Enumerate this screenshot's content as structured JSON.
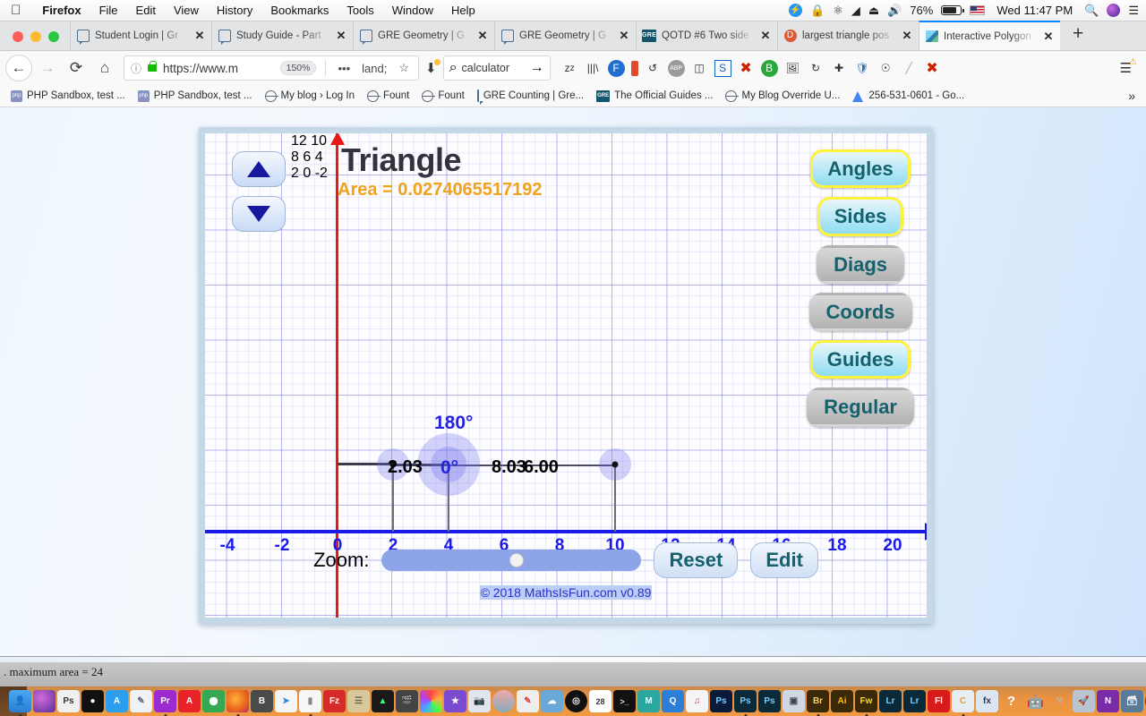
{
  "menubar": {
    "apple_icon": "apple-logo",
    "items": [
      "Firefox",
      "File",
      "Edit",
      "View",
      "History",
      "Bookmarks",
      "Tools",
      "Window",
      "Help"
    ],
    "status_icons": [
      "bluetooth-transfer-icon",
      "lock-icon",
      "bluetooth-icon",
      "wifi-icon",
      "eject-icon",
      "volume-icon"
    ],
    "battery_percent": "76%",
    "flag_icon": "us-flag-icon",
    "clock": "Wed 11:47 PM",
    "search_icon": "spotlight-search-icon",
    "siri_icon": "siri-icon",
    "notifications_icon": "notification-center-icon"
  },
  "tabs": [
    {
      "label": "Student Login | Gr",
      "favicon": "doc-icon",
      "active": false
    },
    {
      "label": "Study Guide - Part",
      "favicon": "doc-icon",
      "active": false
    },
    {
      "label": "GRE Geometry | G",
      "favicon": "doc-icon",
      "active": false
    },
    {
      "label": "GRE Geometry | G",
      "favicon": "doc-icon",
      "active": false
    },
    {
      "label": "QOTD #6 Two side",
      "favicon": "gre-icon",
      "active": false
    },
    {
      "label": "largest triangle pos",
      "favicon": "duckduckgo-icon",
      "active": false
    },
    {
      "label": "Interactive Polygon",
      "favicon": "mathsisfun-icon",
      "active": true
    }
  ],
  "tab_close_label": "✕",
  "newtab_label": "+",
  "navbar": {
    "back_icon": "←",
    "forward_icon": "→",
    "reload_icon": "⟳",
    "home_icon": "⌂",
    "info_icon": "ⓘ",
    "lock_icon": "padlock-icon",
    "url": "https://www.m",
    "zoom_badge": "150%",
    "more_icon": "•••",
    "pocket_icon": "pocket-icon",
    "bookmark_star_icon": "☆",
    "downloads_icon": "⬇",
    "search_icon": "⌕",
    "search_value": "calculator",
    "search_go_icon": "→",
    "extensions": [
      "zzz-icon",
      "library-icon",
      "f-circle-icon",
      "thermometer-icon",
      "loop-icon",
      "abp-icon",
      "panel-icon",
      "s-icon",
      "x-red-icon",
      "b-plus-icon",
      "image-icon",
      "refresh-icon",
      "move-icon",
      "shield-icon",
      "face-icon",
      "pencil-icon",
      "x-red2-icon"
    ],
    "menu_icon": "hamburger-menu-icon",
    "menu_warning_icon": "warning-icon"
  },
  "bookmarks": [
    {
      "label": "PHP Sandbox, test ...",
      "icon": "php-icon"
    },
    {
      "label": "PHP Sandbox, test ...",
      "icon": "php-icon"
    },
    {
      "label": "My blog › Log In",
      "icon": "globe-icon"
    },
    {
      "label": "Fount",
      "icon": "globe-icon"
    },
    {
      "label": "Fount",
      "icon": "globe-icon"
    },
    {
      "label": "GRE Counting | Gre...",
      "icon": "doc-icon"
    },
    {
      "label": "The Official Guides ...",
      "icon": "gre-icon"
    },
    {
      "label": "My Blog Override U...",
      "icon": "globe-icon"
    },
    {
      "label": "256-531-0601 - Go...",
      "icon": "ads-icon"
    }
  ],
  "bookmarks_overflow_icon": "»",
  "app": {
    "title": "Triangle",
    "area_label": "Area = 0.0274065517192",
    "copyright": "© 2018 MathsIsFun.com v0.89",
    "stepper": {
      "up_icon": "triangle-up-icon",
      "down_icon": "triangle-down-icon"
    },
    "toggles": [
      {
        "label": "Angles",
        "active": true
      },
      {
        "label": "Sides",
        "active": true
      },
      {
        "label": "Diags",
        "active": false
      },
      {
        "label": "Coords",
        "active": false
      },
      {
        "label": "Guides",
        "active": true
      },
      {
        "label": "Regular",
        "active": false
      }
    ],
    "zoom_label": "Zoom:",
    "zoom_value": 50,
    "reset_label": "Reset",
    "edit_label": "Edit"
  },
  "chart_data": {
    "type": "scatter",
    "title": "Triangle",
    "subtitle": "Area = 0.0274065517192",
    "xlabel": "",
    "ylabel": "",
    "xlim": [
      -5,
      21
    ],
    "ylim": [
      -3,
      13
    ],
    "grid": true,
    "x_ticks": [
      "-4",
      "-2",
      "0",
      "2",
      "4",
      "6",
      "8",
      "10",
      "12",
      "14",
      "16",
      "18",
      "20"
    ],
    "x_tick_values": [
      -4,
      -2,
      0,
      2,
      4,
      6,
      8,
      10,
      12,
      14,
      16,
      18,
      20
    ],
    "y_ticks": [
      "12",
      "10",
      "8",
      "6",
      "4",
      "2",
      "0",
      "-2"
    ],
    "y_tick_values": [
      12,
      10,
      8,
      6,
      4,
      2,
      0,
      -2
    ],
    "x_axis_color": "#1a1ae8",
    "y_axis_color": "#e81919",
    "vertices": [
      {
        "x": 2.0,
        "y": 2
      },
      {
        "x": 4.03,
        "y": 2
      },
      {
        "x": 10.03,
        "y": 2
      }
    ],
    "side_labels": [
      {
        "text": "2.03",
        "x": 3.0,
        "y": 2
      },
      {
        "text": "8.03",
        "x": 7.1,
        "y": 2
      },
      {
        "text": "6.00",
        "x": 9.3,
        "y": 2
      }
    ],
    "angle_labels": [
      {
        "text": "180°",
        "x": 4.1,
        "y": 3.75
      },
      {
        "text": "0°",
        "x": 4.2,
        "y": 2
      }
    ],
    "annotations": [
      "degenerate triangle: all vertices collinear at y = 2"
    ]
  },
  "statusbar": {
    "text": ". maximum area = 24"
  },
  "dock": {
    "left_items": [
      "finder-icon",
      "siri-icon",
      "photoshop-ps-icon",
      "bomb-icon",
      "appstore-icon",
      "preview-icon",
      "premiere-pr-icon",
      "acrobat-icon",
      "chrome-icon",
      "firefox-icon",
      "bittorrent-icon",
      "safari-icon",
      "pages-icon",
      "filezilla-icon",
      "textedit-icon",
      "activity-monitor-icon",
      "finalcut-icon",
      "colorsync-icon",
      "imovie-icon",
      "screenshot-icon",
      "night-icon",
      "sketch-icon",
      "airdrop-icon",
      "burn-icon",
      "calendar-icon",
      "terminal-icon",
      "mountain-icon",
      "qbit-icon"
    ],
    "right_items": [
      "itunes-icon",
      "photoshop-ps-icon",
      "photoshop-ps-icon",
      "photoshop-ps-icon",
      "scanner-icon",
      "bridge-br-icon",
      "illustrator-ai-icon",
      "fireworks-fw-icon",
      "lightroom-lr-icon",
      "lightroom-lr-icon",
      "flash-fl-icon",
      "c-icon",
      "fx-icon",
      "question-icon",
      "android-icon",
      "grinder-icon",
      "launchpad-icon",
      "onenote-icon",
      "backup-icon",
      "copyright-icon",
      "drive-icon",
      "opera-icon",
      "color-wheel-icon",
      "audition-au-icon"
    ],
    "trailing_items": [
      "documents-stack-icon",
      "downloads-stack-icon",
      "apps-stack-icon",
      "trash-icon"
    ]
  }
}
